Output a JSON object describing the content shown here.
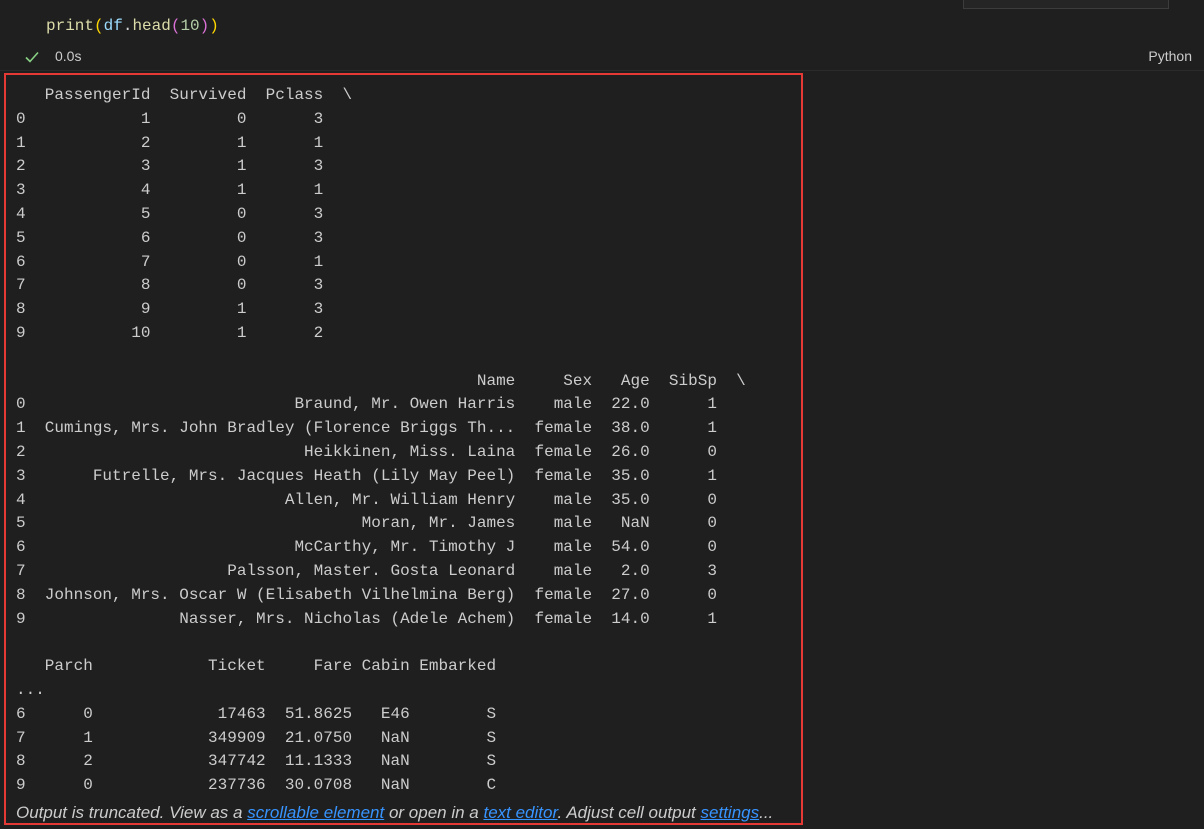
{
  "code_cell": {
    "code": {
      "fn": "print",
      "open1": "(",
      "obj": "df",
      "dot": ".",
      "method": "head",
      "open2": "(",
      "arg": "10",
      "close2": ")",
      "close1": ")"
    },
    "exec_time": "0.0s",
    "language": "Python"
  },
  "output": {
    "text": "   PassengerId  Survived  Pclass  \\\n0            1         0       3   \n1            2         1       1   \n2            3         1       3   \n3            4         1       1   \n4            5         0       3   \n5            6         0       3   \n6            7         0       1   \n7            8         0       3   \n8            9         1       3   \n9           10         1       2   \n\n                                                Name     Sex   Age  SibSp  \\\n0                            Braund, Mr. Owen Harris    male  22.0      1   \n1  Cumings, Mrs. John Bradley (Florence Briggs Th...  female  38.0      1   \n2                             Heikkinen, Miss. Laina  female  26.0      0   \n3       Futrelle, Mrs. Jacques Heath (Lily May Peel)  female  35.0      1   \n4                           Allen, Mr. William Henry    male  35.0      0   \n5                                   Moran, Mr. James    male   NaN      0   \n6                            McCarthy, Mr. Timothy J    male  54.0      0   \n7                     Palsson, Master. Gosta Leonard    male   2.0      3   \n8  Johnson, Mrs. Oscar W (Elisabeth Vilhelmina Berg)  female  27.0      0   \n9                Nasser, Mrs. Nicholas (Adele Achem)  female  14.0      1   \n\n   Parch            Ticket     Fare Cabin Embarked  \n...\n6      0             17463  51.8625   E46        S  \n7      1            349909  21.0750   NaN        S  \n8      2            347742  11.1333   NaN        S  \n9      0            237736  30.0708   NaN        C  ",
    "truncation": {
      "prefix": "Output is truncated. View as a ",
      "link_scrollable": "scrollable element",
      "middle1": " or open in a ",
      "link_editor": "text editor",
      "middle2": ". Adjust cell output ",
      "link_settings": "settings",
      "suffix": "..."
    }
  },
  "colors": {
    "background": "#1f1f1f",
    "highlight_border": "#e53935",
    "link": "#3794ff",
    "success_check": "#89d185"
  },
  "icons": {
    "status": "check-icon"
  }
}
